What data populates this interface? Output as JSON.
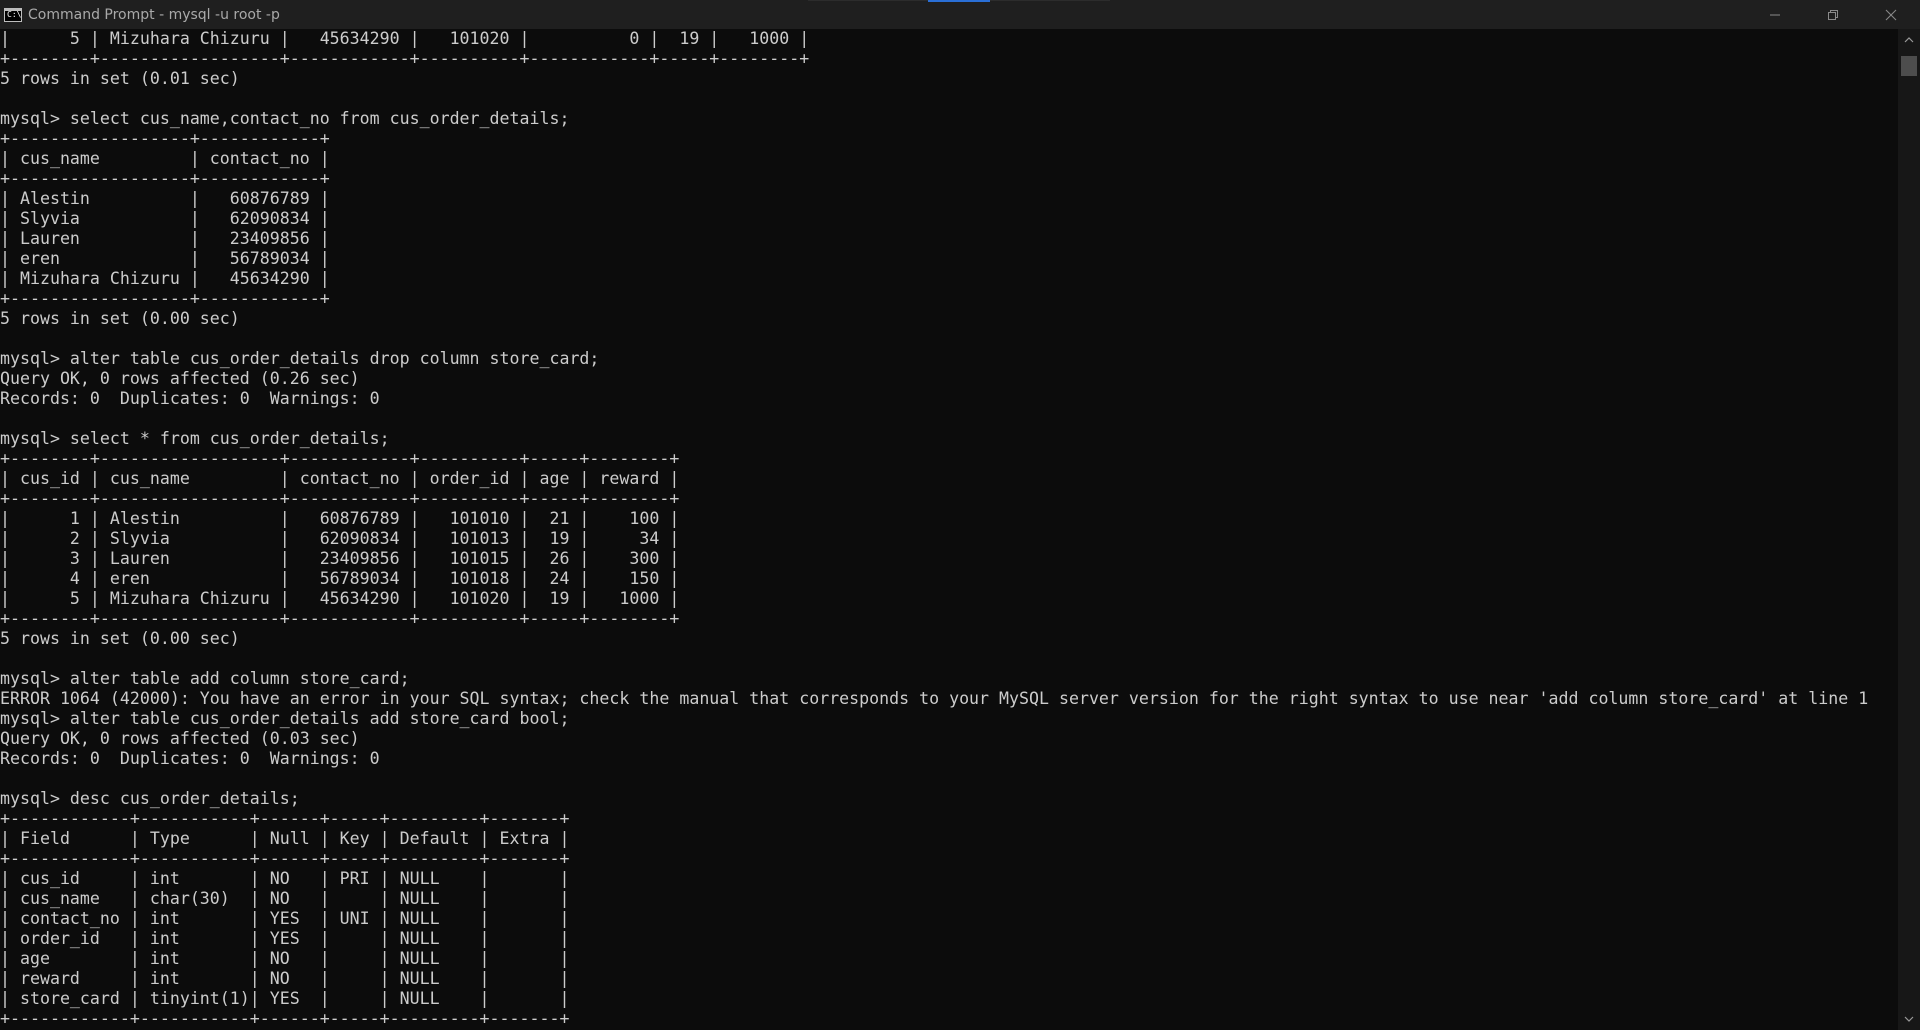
{
  "window": {
    "title": "Command Prompt - mysql  -u root -p",
    "icon": "cmd-icon",
    "controls": [
      "minimize-icon",
      "restore-icon",
      "close-icon"
    ]
  },
  "terminal": {
    "lines": [
      "|      5 | Mizuhara Chizuru |   45634290 |   101020 |          0 |  19 |   1000 |",
      "+--------+------------------+------------+----------+------------+-----+--------+",
      "5 rows in set (0.01 sec)",
      "",
      "mysql> select cus_name,contact_no from cus_order_details;",
      "+------------------+------------+",
      "| cus_name         | contact_no |",
      "+------------------+------------+",
      "| Alestin          |   60876789 |",
      "| Slyvia           |   62090834 |",
      "| Lauren           |   23409856 |",
      "| eren             |   56789034 |",
      "| Mizuhara Chizuru |   45634290 |",
      "+------------------+------------+",
      "5 rows in set (0.00 sec)",
      "",
      "mysql> alter table cus_order_details drop column store_card;",
      "Query OK, 0 rows affected (0.26 sec)",
      "Records: 0  Duplicates: 0  Warnings: 0",
      "",
      "mysql> select * from cus_order_details;",
      "+--------+------------------+------------+----------+-----+--------+",
      "| cus_id | cus_name         | contact_no | order_id | age | reward |",
      "+--------+------------------+------------+----------+-----+--------+",
      "|      1 | Alestin          |   60876789 |   101010 |  21 |    100 |",
      "|      2 | Slyvia           |   62090834 |   101013 |  19 |     34 |",
      "|      3 | Lauren           |   23409856 |   101015 |  26 |    300 |",
      "|      4 | eren             |   56789034 |   101018 |  24 |    150 |",
      "|      5 | Mizuhara Chizuru |   45634290 |   101020 |  19 |   1000 |",
      "+--------+------------------+------------+----------+-----+--------+",
      "5 rows in set (0.00 sec)",
      "",
      "mysql> alter table add column store_card;",
      "ERROR 1064 (42000): You have an error in your SQL syntax; check the manual that corresponds to your MySQL server version for the right syntax to use near 'add column store_card' at line 1",
      "mysql> alter table cus_order_details add store_card bool;",
      "Query OK, 0 rows affected (0.03 sec)",
      "Records: 0  Duplicates: 0  Warnings: 0",
      "",
      "mysql> desc cus_order_details;",
      "+------------+-----------+------+-----+---------+-------+",
      "| Field      | Type      | Null | Key | Default | Extra |",
      "+------------+-----------+------+-----+---------+-------+",
      "| cus_id     | int       | NO   | PRI | NULL    |       |",
      "| cus_name   | char(30)  | NO   |     | NULL    |       |",
      "| contact_no | int       | YES  | UNI | NULL    |       |",
      "| order_id   | int       | YES  |     | NULL    |       |",
      "| age        | int       | NO   |     | NULL    |       |",
      "| reward     | int       | NO   |     | NULL    |       |",
      "| store_card | tinyint(1)| YES  |     | NULL    |       |",
      "+------------+-----------+------+-----+---------+-------+"
    ]
  },
  "colors": {
    "background": "#0c0c0c",
    "foreground": "#cccccc",
    "titlebar": "#1f1f1f",
    "title_text": "#a9a9a9"
  }
}
